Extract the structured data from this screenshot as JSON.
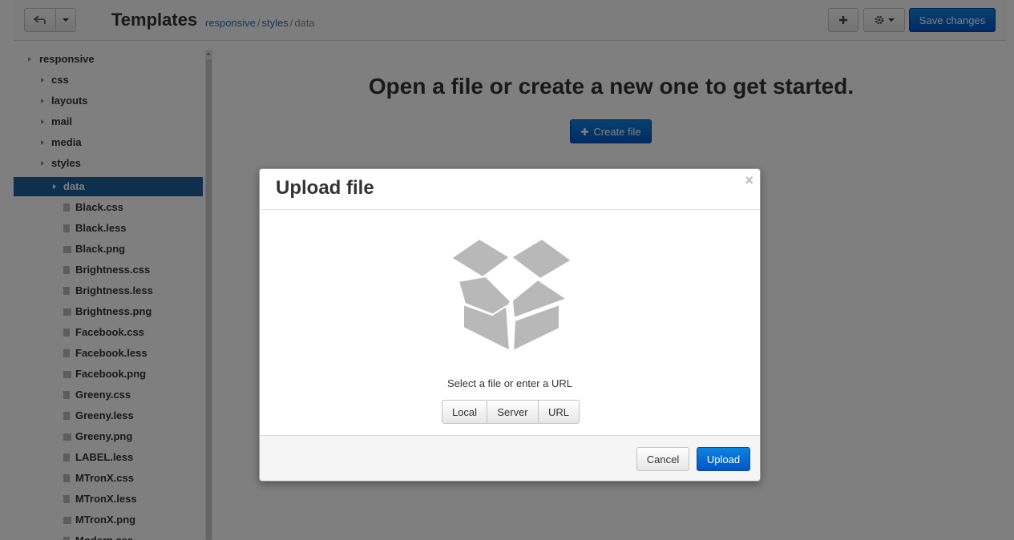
{
  "toolbar": {
    "title": "Templates",
    "breadcrumb": [
      "responsive",
      "styles",
      "data"
    ],
    "save_label": "Save changes"
  },
  "sidebar": {
    "folders": [
      "responsive",
      "css",
      "layouts",
      "mail",
      "media",
      "styles"
    ],
    "active_folder": "data",
    "files": [
      "Black.css",
      "Black.less",
      "Black.png",
      "Brightness.css",
      "Brightness.less",
      "Brightness.png",
      "Facebook.css",
      "Facebook.less",
      "Facebook.png",
      "Greeny.css",
      "Greeny.less",
      "Greeny.png",
      "LABEL.less",
      "MTronX.css",
      "MTronX.less",
      "MTronX.png",
      "Modern.css"
    ]
  },
  "main": {
    "empty_heading": "Open a file or create a new one to get started.",
    "create_label": "Create file"
  },
  "modal": {
    "title": "Upload file",
    "close": "×",
    "prompt": "Select a file or enter a URL",
    "sources": [
      "Local",
      "Server",
      "URL"
    ],
    "cancel_label": "Cancel",
    "upload_label": "Upload"
  },
  "icons": {
    "back": "back-arrow-icon",
    "dropdown": "caret-down-icon",
    "plus": "plus-icon",
    "settings": "gear-icon",
    "folder_toggle": "caret-right-icon",
    "file": "file-icon",
    "image": "image-file-icon",
    "box": "open-box-icon"
  },
  "colors": {
    "primary": "#0454c6",
    "active_row": "#1f5f9e",
    "link": "#2a6ebb",
    "backdrop": "rgba(0,0,0,0.5)"
  }
}
